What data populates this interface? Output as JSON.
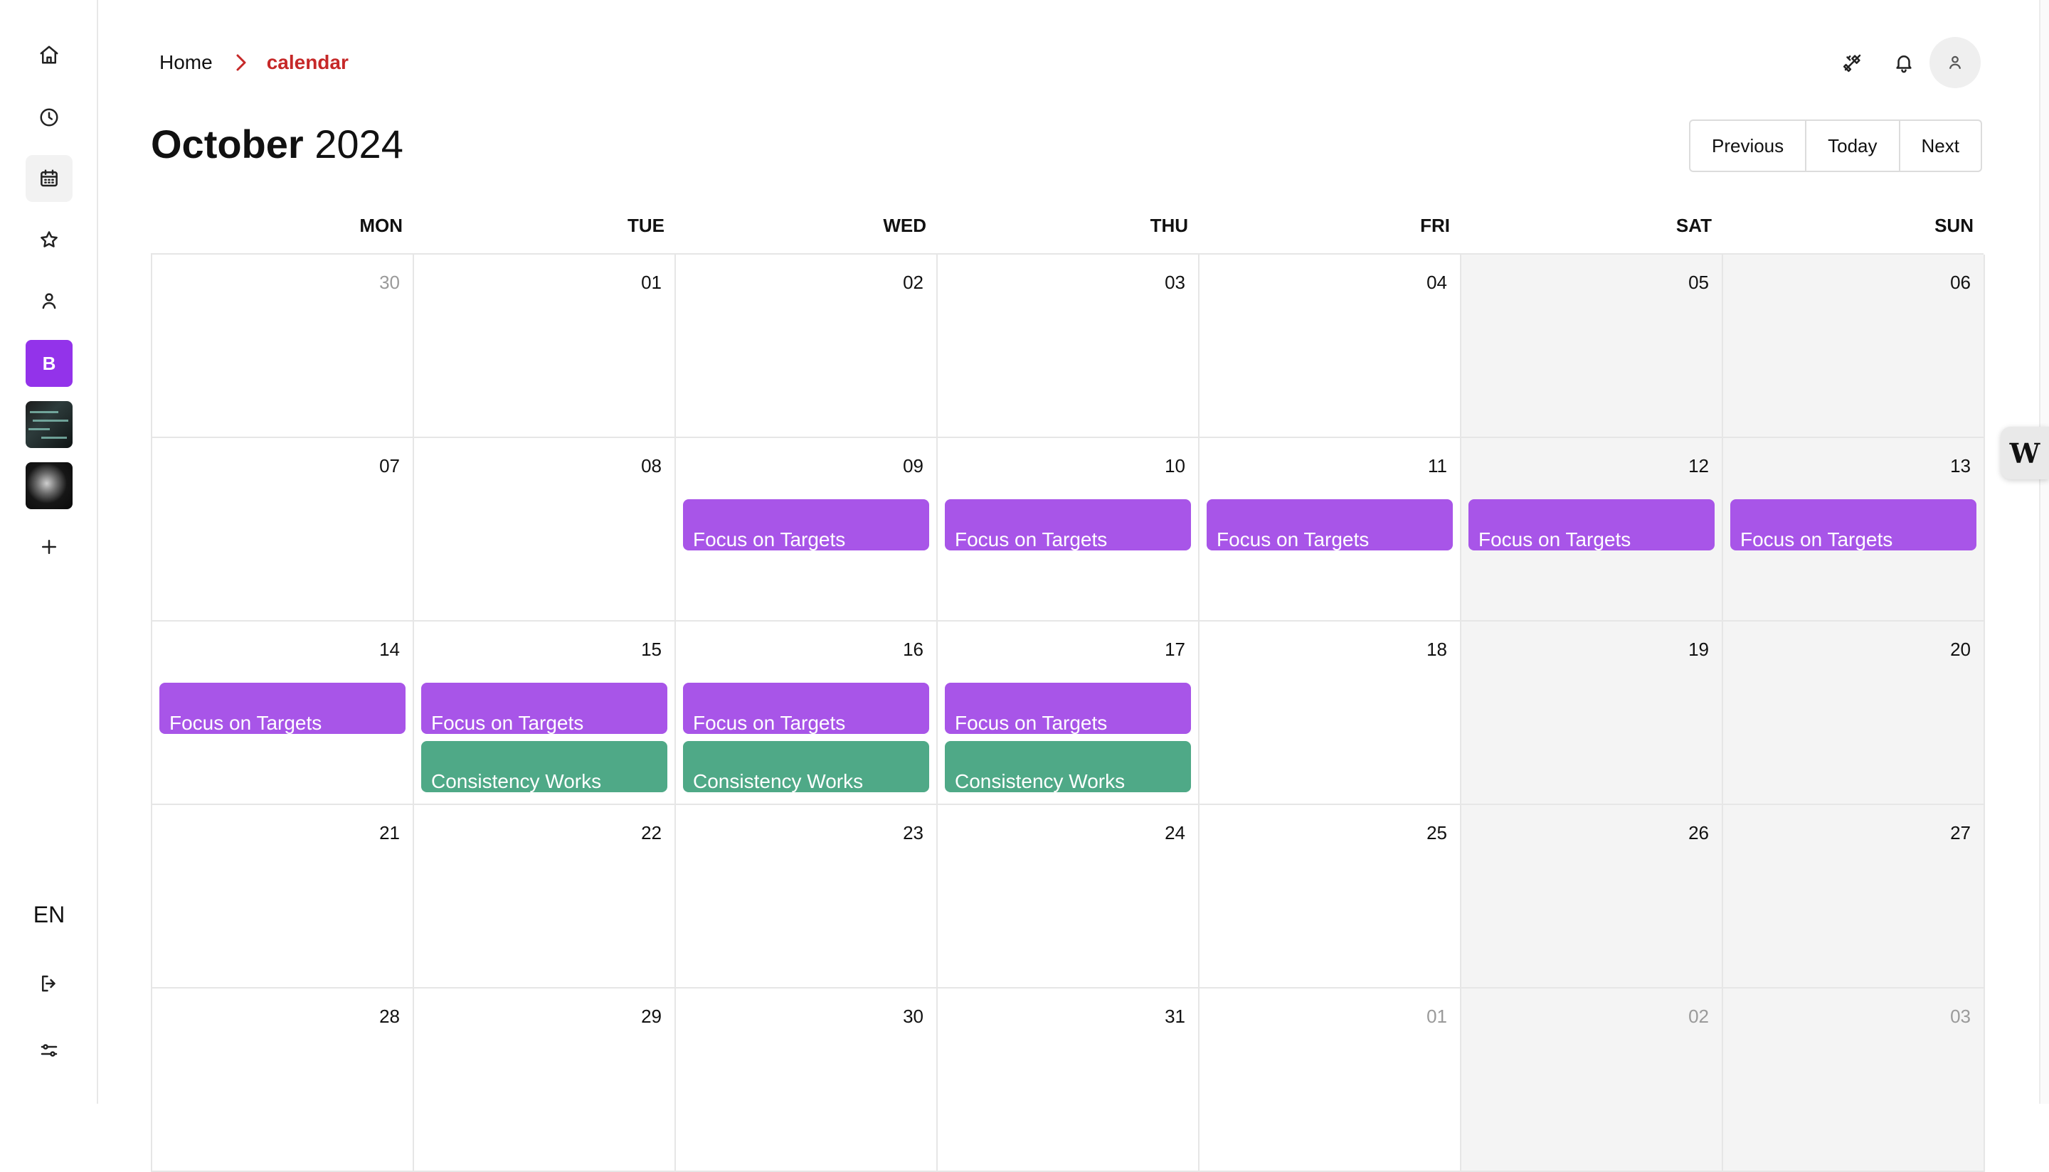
{
  "sidebar": {
    "items": [
      {
        "name": "home-icon"
      },
      {
        "name": "clock-icon"
      },
      {
        "name": "calendar-icon"
      },
      {
        "name": "star-icon"
      },
      {
        "name": "user-icon"
      }
    ],
    "workspaces": [
      {
        "label": "B",
        "color": "#9333ea"
      }
    ],
    "language": "EN"
  },
  "header": {
    "breadcrumb": {
      "home": "Home",
      "current": "calendar"
    },
    "current_color": "#c62828"
  },
  "calendar": {
    "month": "October",
    "year": "2024",
    "buttons": {
      "previous": "Previous",
      "today": "Today",
      "next": "Next"
    },
    "weekdays": [
      "MON",
      "TUE",
      "WED",
      "THU",
      "FRI",
      "SAT",
      "SUN"
    ],
    "weeks": [
      [
        {
          "day": "30",
          "other": true,
          "events": []
        },
        {
          "day": "01",
          "events": []
        },
        {
          "day": "02",
          "events": []
        },
        {
          "day": "03",
          "events": []
        },
        {
          "day": "04",
          "events": []
        },
        {
          "day": "05",
          "events": []
        },
        {
          "day": "06",
          "events": []
        }
      ],
      [
        {
          "day": "07",
          "events": []
        },
        {
          "day": "08",
          "events": []
        },
        {
          "day": "09",
          "events": [
            "Focus on Targets"
          ]
        },
        {
          "day": "10",
          "events": [
            "Focus on Targets"
          ]
        },
        {
          "day": "11",
          "events": [
            "Focus on Targets"
          ]
        },
        {
          "day": "12",
          "events": [
            "Focus on Targets"
          ]
        },
        {
          "day": "13",
          "events": [
            "Focus on Targets"
          ]
        }
      ],
      [
        {
          "day": "14",
          "events": [
            "Focus on Targets"
          ]
        },
        {
          "day": "15",
          "events": [
            "Focus on Targets",
            "Consistency Works"
          ]
        },
        {
          "day": "16",
          "events": [
            "Focus on Targets",
            "Consistency Works"
          ]
        },
        {
          "day": "17",
          "events": [
            "Focus on Targets",
            "Consistency Works"
          ]
        },
        {
          "day": "18",
          "events": []
        },
        {
          "day": "19",
          "events": []
        },
        {
          "day": "20",
          "events": []
        }
      ],
      [
        {
          "day": "21",
          "events": []
        },
        {
          "day": "22",
          "events": []
        },
        {
          "day": "23",
          "events": []
        },
        {
          "day": "24",
          "events": []
        },
        {
          "day": "25",
          "events": []
        },
        {
          "day": "26",
          "events": []
        },
        {
          "day": "27",
          "events": []
        }
      ],
      [
        {
          "day": "28",
          "events": []
        },
        {
          "day": "29",
          "events": []
        },
        {
          "day": "30",
          "events": []
        },
        {
          "day": "31",
          "events": []
        },
        {
          "day": "01",
          "other": true,
          "events": []
        },
        {
          "day": "02",
          "other": true,
          "events": []
        },
        {
          "day": "03",
          "other": true,
          "events": []
        }
      ]
    ],
    "event_colors": {
      "Focus on Targets": "#a855e8",
      "Consistency Works": "#4fa987"
    }
  },
  "floating_widget": {
    "label": "W"
  }
}
